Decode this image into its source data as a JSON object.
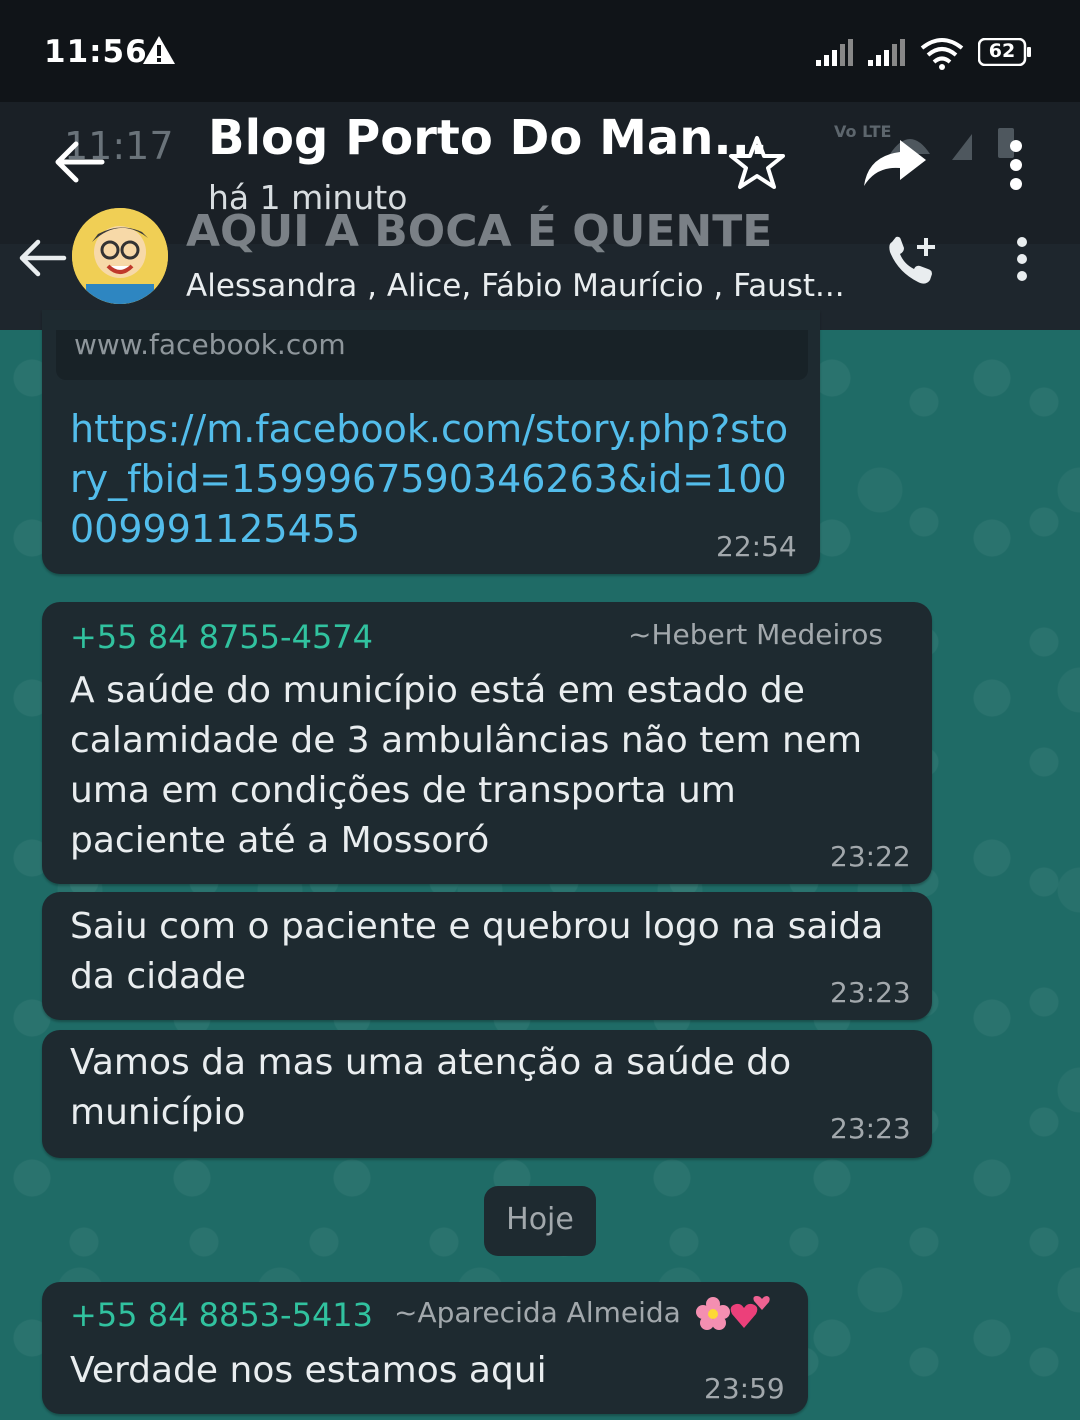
{
  "status_bar": {
    "time": "11:56",
    "battery": "62"
  },
  "story": {
    "ghost_time": "11:17",
    "title": "Blog Porto Do Man...",
    "subtitle": "há 1 minuto",
    "ghost_network": "Vo LTE"
  },
  "chat_header": {
    "group_name": "AQUI A BOCA É QUENTE",
    "members": "Alessandra , Alice, Fábio Maurício , Faust..."
  },
  "messages": {
    "link": {
      "domain": "www.facebook.com",
      "url": "https://m.facebook.com/story.php?story_fbid=1599967590346263&id=100009991125455",
      "time": "22:54"
    },
    "m1": {
      "sender_number": "+55 84 8755-4574",
      "sender_name": "~Hebert Medeiros",
      "text": "A saúde do município está em estado de calamidade de 3 ambulâncias não tem nem uma em condições de transporta um paciente até a Mossoró",
      "time": "23:22"
    },
    "m2": {
      "text": "Saiu com o paciente e quebrou logo na saida da cidade",
      "time": "23:23"
    },
    "m3": {
      "text": "Vamos da mas uma atenção a saúde do município",
      "time": "23:23"
    },
    "day_separator": "Hoje",
    "m4": {
      "sender_number": "+55 84 8853-5413",
      "sender_name": "~Aparecida Almeida",
      "text": "Verdade nos estamos aqui",
      "time": "23:59"
    }
  },
  "colors": {
    "chat_background": "#1f6b66",
    "bubble": "#1e2a30",
    "link": "#53bdeb",
    "sender": "#31c29f"
  },
  "icons": [
    "warning-icon",
    "signal-icon",
    "wifi-icon",
    "battery-icon",
    "back-arrow-icon",
    "star-icon",
    "share-icon",
    "menu-icon",
    "add-call-icon"
  ]
}
